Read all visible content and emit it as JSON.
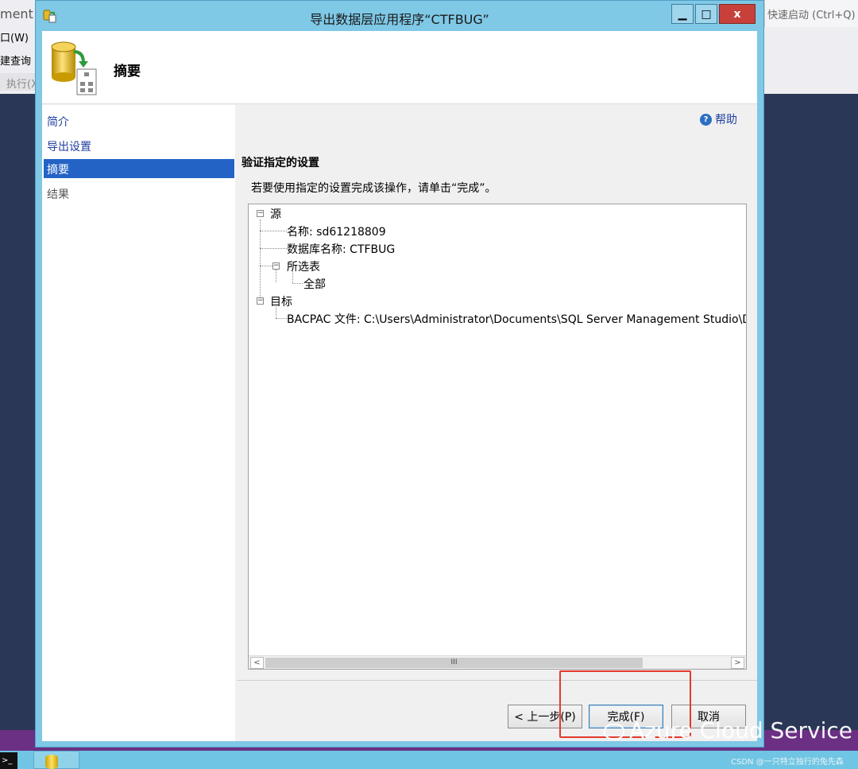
{
  "background_app": {
    "title_fragment": "ment",
    "menu_fragment": "口(W)",
    "new_query_fragment": "建查询",
    "execute_fragment": "执行(X",
    "quick_launch": "快速启动 (Ctrl+Q)"
  },
  "dialog": {
    "title": "导出数据层应用程序“CTFBUG”",
    "window_controls": {
      "minimize": "▁",
      "maximize": "□",
      "close": "x"
    },
    "header_title": "摘要",
    "nav": [
      {
        "label": "简介",
        "state": "link"
      },
      {
        "label": "导出设置",
        "state": "link"
      },
      {
        "label": "摘要",
        "state": "active"
      },
      {
        "label": "结果",
        "state": "disabled"
      }
    ],
    "help_label": "帮助",
    "section_title": "验证指定的设置",
    "instructions": "若要使用指定的设置完成该操作，请单击“完成”。",
    "tree": {
      "source_label": "源",
      "name_item": "名称: sd61218809",
      "db_name_item": "数据库名称: CTFBUG",
      "selected_tables_label": "所选表",
      "all_item": "全部",
      "target_label": "目标",
      "bacpac_item": "BACPAC 文件: C:\\Users\\Administrator\\Documents\\SQL Server Management Studio\\DAC Pa"
    },
    "scrollbar": {
      "left": "<",
      "thumb": "III",
      "right": ">"
    },
    "buttons": {
      "back": "< 上一步(P)",
      "finish": "完成(F)",
      "cancel": "取消"
    }
  },
  "watermark": "Azure Cloud Service",
  "credit": "CSDN @一只特立独行的兔先森",
  "colors": {
    "accent": "#2463c6",
    "titlebar": "#7fc8e6",
    "highlight_box": "#e23a2e"
  }
}
